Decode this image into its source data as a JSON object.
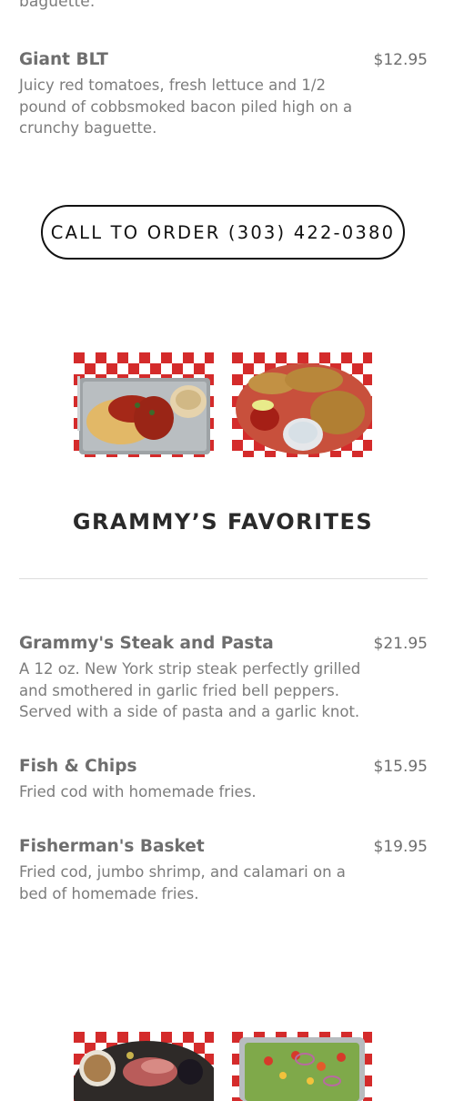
{
  "top_cut_text": "baguette.",
  "items_top": [
    {
      "name": "Giant BLT",
      "price": "$12.95",
      "description": "Juicy red tomatoes, fresh lettuce and 1/2 pound of cobbsmoked bacon piled high on a crunchy baguette."
    }
  ],
  "cta": {
    "label": "CALL TO ORDER (303) 422-0380"
  },
  "section": {
    "title": "GRAMMY’S FAVORITES"
  },
  "items": [
    {
      "name": "Grammy's Steak and Pasta",
      "price": "$21.95",
      "description": "A 12 oz. New York strip steak perfectly grilled and smothered in garlic fried bell peppers. Served with a side of pasta and a garlic knot."
    },
    {
      "name": "Fish & Chips",
      "price": "$15.95",
      "description": "Fried cod with homemade fries."
    },
    {
      "name": "Fisherman's Basket",
      "price": "$19.95",
      "description": "Fried cod, jumbo shrimp, and calamari on a bed of homemade fries."
    }
  ],
  "colors": {
    "accent_red": "#d42b2b",
    "text": "#6e6e6e",
    "heading": "#2a2a2a"
  }
}
